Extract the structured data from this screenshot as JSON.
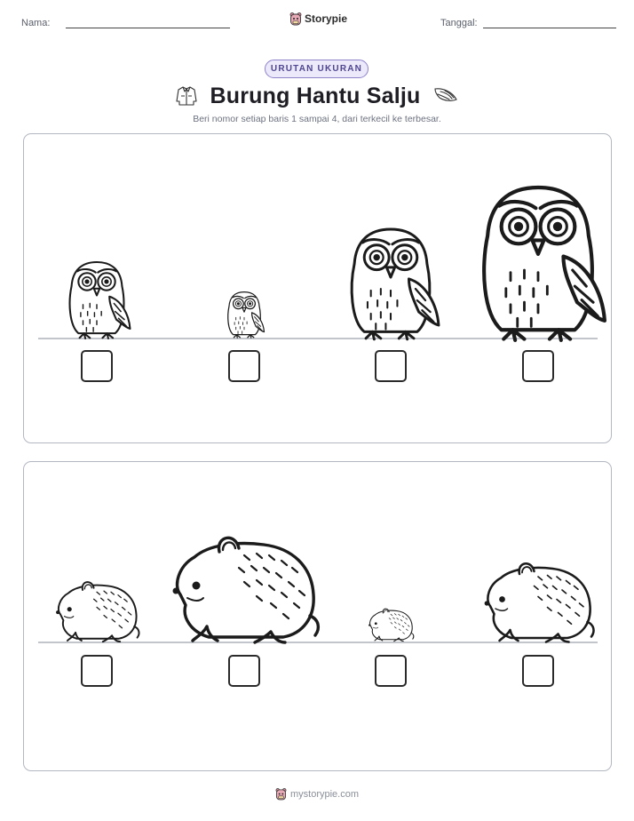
{
  "header": {
    "name_label": "Nama:",
    "date_label": "Tanggal:",
    "brand_name": "Storypie",
    "brand_logo_icon": "storypie-mascot-icon"
  },
  "worksheet": {
    "badge": "URUTAN UKURAN",
    "title": "Burung Hantu Salju",
    "title_left_icon": "jacket-icon",
    "title_right_icon": "wing-icon",
    "instructions": "Beri nomor setiap baris 1 sampai 4, dari terkecil ke terbesar."
  },
  "rows": [
    {
      "subject": "owl",
      "items": [
        {
          "animal": "owl",
          "relative_size": 0.5
        },
        {
          "animal": "owl",
          "relative_size": 0.3
        },
        {
          "animal": "owl",
          "relative_size": 0.72
        },
        {
          "animal": "owl",
          "relative_size": 1.0
        }
      ]
    },
    {
      "subject": "lemming",
      "items": [
        {
          "animal": "lemming",
          "relative_size": 0.57
        },
        {
          "animal": "lemming",
          "relative_size": 1.0
        },
        {
          "animal": "lemming",
          "relative_size": 0.31
        },
        {
          "animal": "lemming",
          "relative_size": 0.75
        }
      ]
    }
  ],
  "footer": {
    "url": "mystorypie.com"
  },
  "colors": {
    "badge_border": "#8e82c9",
    "badge_bg": "#ece9fb",
    "panel_border": "#b3b7c2",
    "ground_line": "#9ea3ad"
  }
}
